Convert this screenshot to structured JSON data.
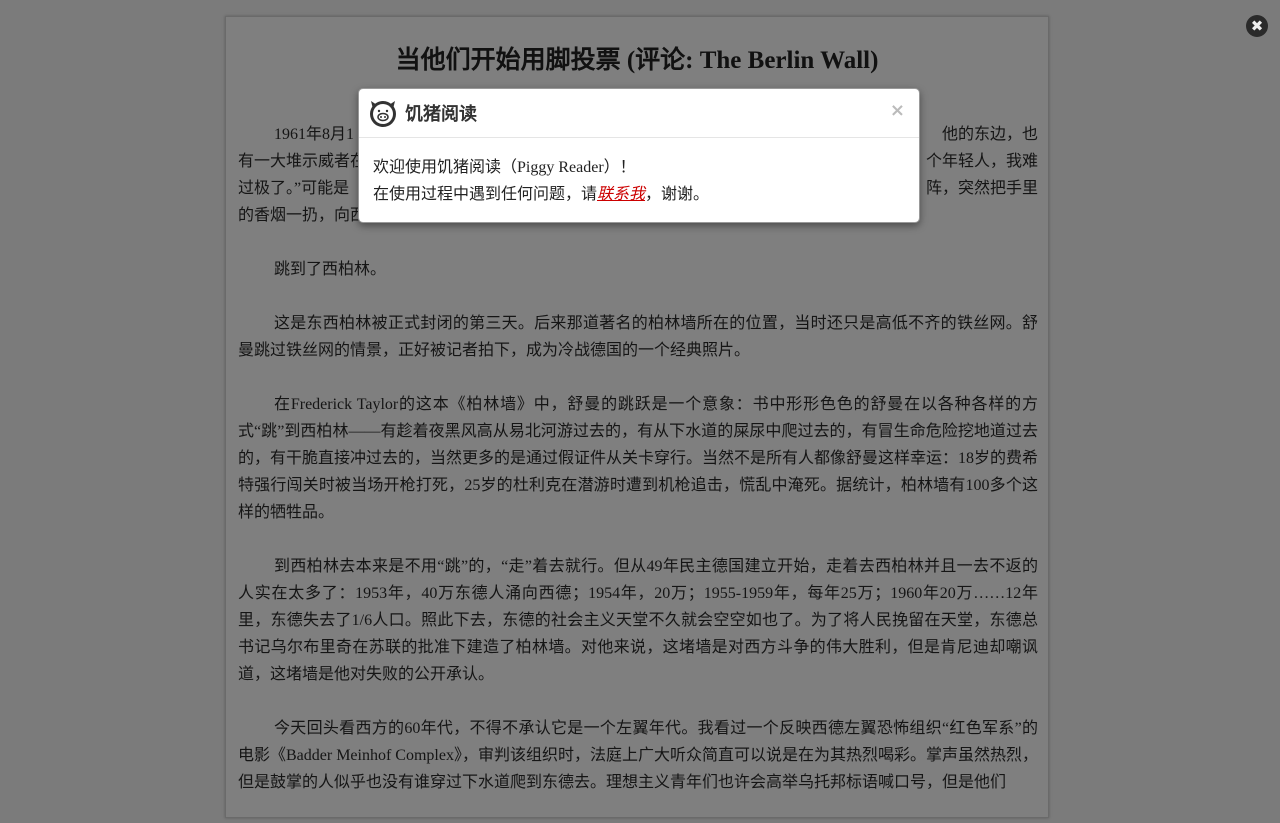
{
  "article": {
    "title": "当他们开始用脚投票 (评论: The Berlin Wall)",
    "first_paragraph_visible_fragments": [
      [
        "1961年8月1",
        "他的东边，也"
      ],
      [
        "有一大堆示威者在",
        "个年轻人，我难"
      ],
      [
        "过极了。”可能是",
        "阵，突然把手里"
      ],
      [
        "的香烟一扔，向西",
        ""
      ]
    ],
    "paragraphs": [
      "跳到了西柏林。",
      "这是东西柏林被正式封闭的第三天。后来那道著名的柏林墙所在的位置，当时还只是高低不齐的铁丝网。舒曼跳过铁丝网的情景，正好被记者拍下，成为冷战德国的一个经典照片。",
      "在Frederick Taylor的这本《柏林墙》中，舒曼的跳跃是一个意象：书中形形色色的舒曼在以各种各样的方式“跳”到西柏林——有趁着夜黑风高从易北河游过去的，有从下水道的屎尿中爬过去的，有冒生命危险挖地道过去的，有干脆直接冲过去的，当然更多的是通过假证件从关卡穿行。当然不是所有人都像舒曼这样幸运：18岁的费希特强行闯关时被当场开枪打死，25岁的杜利克在潜游时遭到机枪追击，慌乱中淹死。据统计，柏林墙有100多个这样的牺牲品。",
      "到西柏林去本来是不用“跳”的，“走”着去就行。但从49年民主德国建立开始，走着去西柏林并且一去不返的人实在太多了：1953年，40万东德人涌向西德；1954年，20万；1955-1959年，每年25万；1960年20万……12年里，东德失去了1/6人口。照此下去，东德的社会主义天堂不久就会空空如也了。为了将人民挽留在天堂，东德总书记乌尔布里奇在苏联的批准下建造了柏林墙。对他来说，这堵墙是对西方斗争的伟大胜利，但是肯尼迪却嘲讽道，这堵墙是他对失败的公开承认。",
      "今天回头看西方的60年代，不得不承认它是一个左翼年代。我看过一个反映西德左翼恐怖组织“红色军系”的电影《Badder Meinhof Complex》，审判该组织时，法庭上广大听众简直可以说是在为其热烈喝彩。掌声虽然热烈，但是鼓掌的人似乎也没有谁穿过下水道爬到东德去。理想主义青年们也许会高举乌托邦标语喊口号，但是他们"
    ]
  },
  "page_close_label": "✖",
  "modal": {
    "title": "饥猪阅读",
    "close_label": "×",
    "line1": "欢迎使用饥猪阅读（Piggy Reader）！",
    "line2_before": "在使用过程中遇到任何问题，请",
    "link": "联系我",
    "line2_after": "，谢谢。"
  }
}
